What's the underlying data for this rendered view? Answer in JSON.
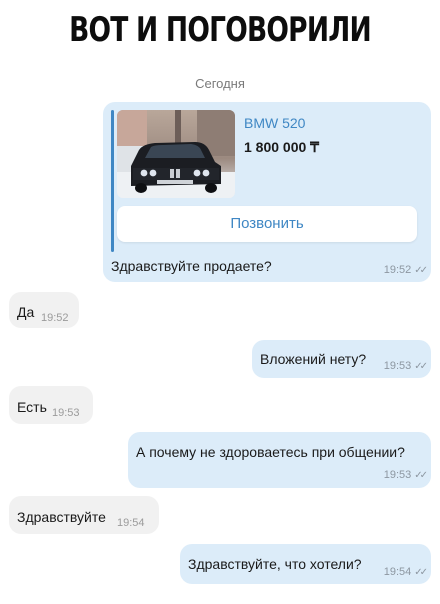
{
  "headline": "ВОТ И ПОГОВОРИЛИ",
  "date_separator": "Сегодня",
  "listing": {
    "title": "BMW 520",
    "price": "1 800 000 ₸",
    "call_button": "Позвонить"
  },
  "messages": [
    {
      "direction": "out",
      "text": "Здравствуйте продаете?",
      "time": "19:52",
      "status": "read"
    },
    {
      "direction": "in",
      "text": "Да",
      "time": "19:52"
    },
    {
      "direction": "out",
      "text": "Вложений нету?",
      "time": "19:53",
      "status": "read"
    },
    {
      "direction": "in",
      "text": "Есть",
      "time": "19:53"
    },
    {
      "direction": "out",
      "text": "А почему не здороваетесь при общении?",
      "time": "19:53",
      "status": "read"
    },
    {
      "direction": "in",
      "text": "Здравствуйте",
      "time": "19:54"
    },
    {
      "direction": "out",
      "text": "Здравствуйте, что хотели?",
      "time": "19:54",
      "status": "read"
    }
  ],
  "colors": {
    "outgoing_bubble": "#dcecf9",
    "incoming_bubble": "#f1f1f1",
    "accent": "#3f87c4"
  },
  "icons": {
    "read_status": "double-check-icon"
  }
}
